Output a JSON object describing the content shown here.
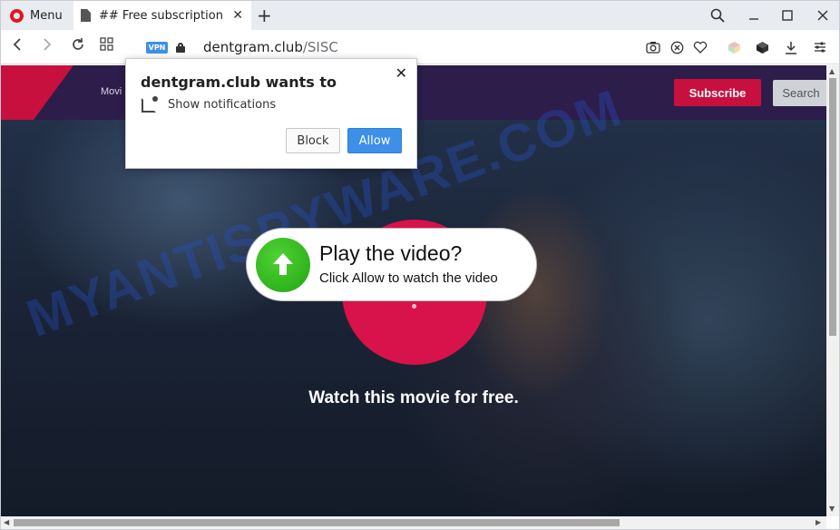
{
  "browser": {
    "menu_label": "Menu",
    "tab_title": "## Free subscription",
    "vpn_badge": "VPN",
    "url_host": "dentgram.club",
    "url_path": "/SISC"
  },
  "site": {
    "nav_link": "Movi",
    "subscribe_label": "Subscribe",
    "search_label": "Search",
    "watermark": "MYANTISPYWARE.COM",
    "promo_title": "Play the video?",
    "promo_sub": "Click Allow to watch the video",
    "caption": "Watch this movie for free."
  },
  "popup": {
    "title": "dentgram.club wants to",
    "permission": "Show notifications",
    "block_label": "Block",
    "allow_label": "Allow"
  },
  "colors": {
    "accent_red": "#c8103f",
    "allow_blue": "#3d8fe8",
    "nav_purple": "#2c1d4a",
    "play_green": "#22a514"
  }
}
